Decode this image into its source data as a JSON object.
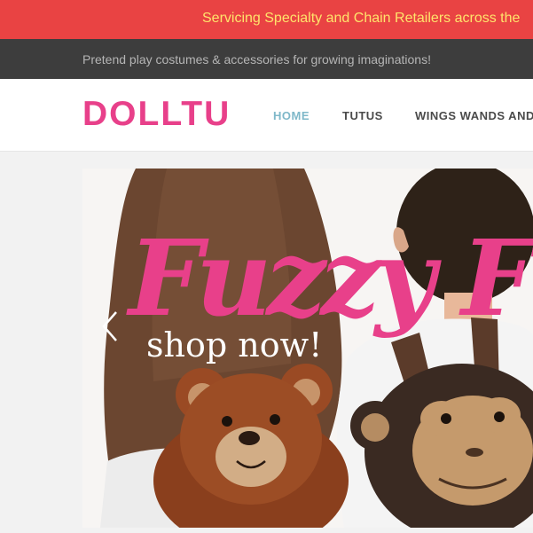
{
  "announcement": {
    "text": "Servicing Specialty and Chain Retailers across the"
  },
  "tagline": {
    "text": "Pretend play costumes & accessories for growing imaginations!"
  },
  "header": {
    "logo": "DOLLTU",
    "nav": [
      {
        "label": "HOME",
        "active": true
      },
      {
        "label": "TUTUS",
        "active": false
      },
      {
        "label": "WINGS WANDS AND",
        "active": false
      }
    ]
  },
  "slider": {
    "headline": "Fuzzy Fr",
    "cta": "shop now!",
    "prev_icon": "chevron-left-icon"
  },
  "colors": {
    "announce_bg": "#e94343",
    "announce_text": "#ffe36b",
    "tagbar_bg": "#3d3d3d",
    "brand_pink": "#e8408a",
    "nav_active": "#7fb8c9"
  }
}
